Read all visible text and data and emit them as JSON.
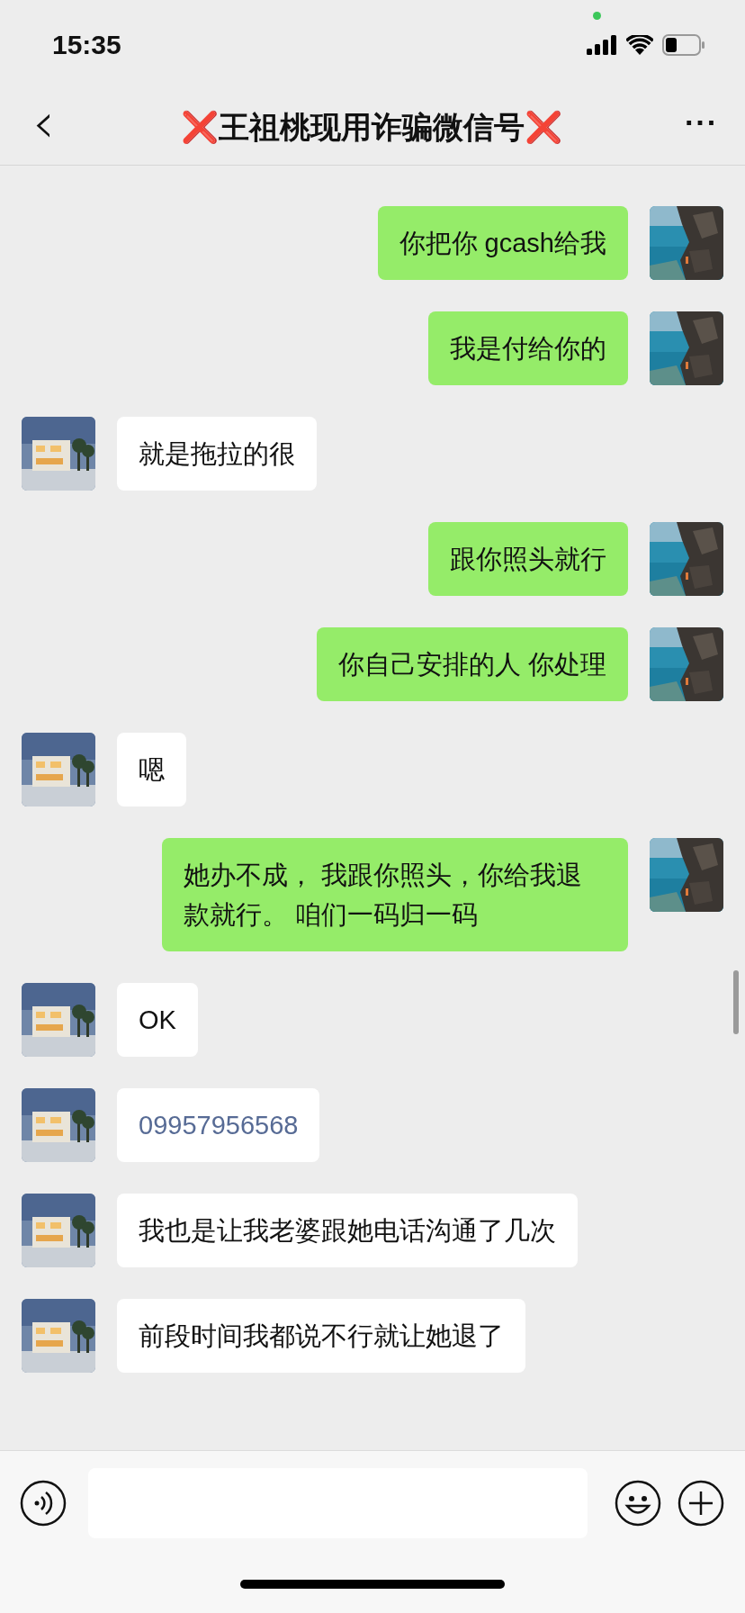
{
  "status_bar": {
    "time": "15:35"
  },
  "nav": {
    "back": "‹",
    "title": {
      "prefix": "❌",
      "text": "王祖桃现用诈骗微信号",
      "suffix": "❌"
    },
    "more": "···"
  },
  "messages": [
    {
      "outgoing": true,
      "kind": "text",
      "text": "你把你 gcash给我"
    },
    {
      "outgoing": true,
      "kind": "text",
      "text": "我是付给你的"
    },
    {
      "outgoing": false,
      "kind": "text",
      "text": "就是拖拉的很"
    },
    {
      "outgoing": true,
      "kind": "text",
      "text": "跟你照头就行"
    },
    {
      "outgoing": true,
      "kind": "text",
      "text": "你自己安排的人 你处理"
    },
    {
      "outgoing": false,
      "kind": "text",
      "text": "嗯"
    },
    {
      "outgoing": true,
      "kind": "text",
      "text": "她办不成， 我跟你照头，你给我退款就行。 咱们一码归一码"
    },
    {
      "outgoing": false,
      "kind": "text",
      "text": "OK"
    },
    {
      "outgoing": false,
      "kind": "link",
      "text": "09957956568"
    },
    {
      "outgoing": false,
      "kind": "text",
      "text": "我也是让我老婆跟她电话沟通了几次"
    },
    {
      "outgoing": false,
      "kind": "text",
      "text": "前段时间我都说不行就让她退了"
    }
  ]
}
